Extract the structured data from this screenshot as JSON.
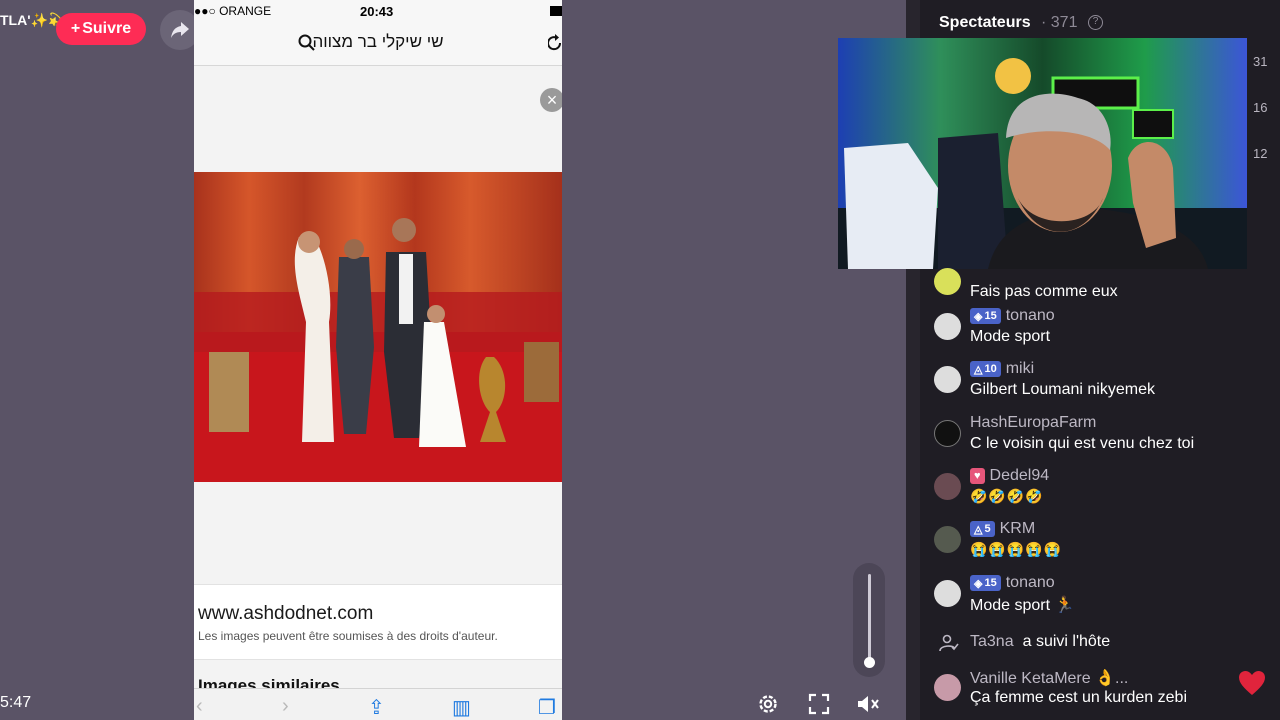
{
  "stage": {
    "host_name": "TLA'✨💫",
    "follow_label": "Suivre",
    "follow_plus": "+",
    "timer": "5:47"
  },
  "phone": {
    "carrier": "●●○ ORANGE",
    "time": "20:43",
    "search_query": "שי שיקלי בר מצווה",
    "source_domain": "www.ashdodnet.com",
    "source_note": "Les images peuvent être soumises à des droits d'auteur.",
    "similar_label": "Images similaires"
  },
  "panel": {
    "title": "Spectateurs",
    "viewer_count": "· 371",
    "side_numbers": [
      "31",
      "16",
      "12"
    ]
  },
  "chat": [
    {
      "name": "",
      "badge": "",
      "msg": "Fais pas comme eux",
      "avatar_color": "#d9e05a"
    },
    {
      "name": "tonano",
      "badge": "15",
      "badge_icon": "◈",
      "msg": "Mode sport",
      "avatar_color": "#e3e3e3"
    },
    {
      "name": "miki",
      "badge": "10",
      "badge_icon": "◬",
      "msg": "Gilbert Loumani nikyemek",
      "avatar_color": "#e3e3e3"
    },
    {
      "name": "HashEuropaFarm",
      "badge": "",
      "msg": "C le voisin qui est venu chez toi",
      "avatar_color": "#111111"
    },
    {
      "name": "Dedel94",
      "badge": "♥",
      "badge_icon": "",
      "msg": "🤣🤣🤣🤣",
      "avatar_color": "#6a4b52"
    },
    {
      "name": "KRM",
      "badge": "5",
      "badge_icon": "◬",
      "msg": "😭😭😭😭😭",
      "avatar_color": "#555a4f"
    },
    {
      "name": "tonano",
      "badge": "15",
      "badge_icon": "◈",
      "msg": "Mode sport 🏃",
      "avatar_color": "#e3e3e3"
    },
    {
      "name": "Ta3na",
      "badge": "",
      "msg": "a suivi l'hôte",
      "avatar_color": ""
    },
    {
      "name": "Vanille KetaMere 👌...",
      "badge": "",
      "msg": "Ça femme cest un kurden zebi",
      "avatar_color": "#c79aa8"
    }
  ],
  "icons": {
    "share": "share-arrow-icon",
    "settings": "gear-icon",
    "fullscreen": "fullscreen-icon",
    "mute": "speaker-mute-icon",
    "heart": "heart-icon"
  },
  "colors": {
    "follow": "#fe2c55",
    "badge": "#4a63c8",
    "heart": "#e0243c"
  }
}
